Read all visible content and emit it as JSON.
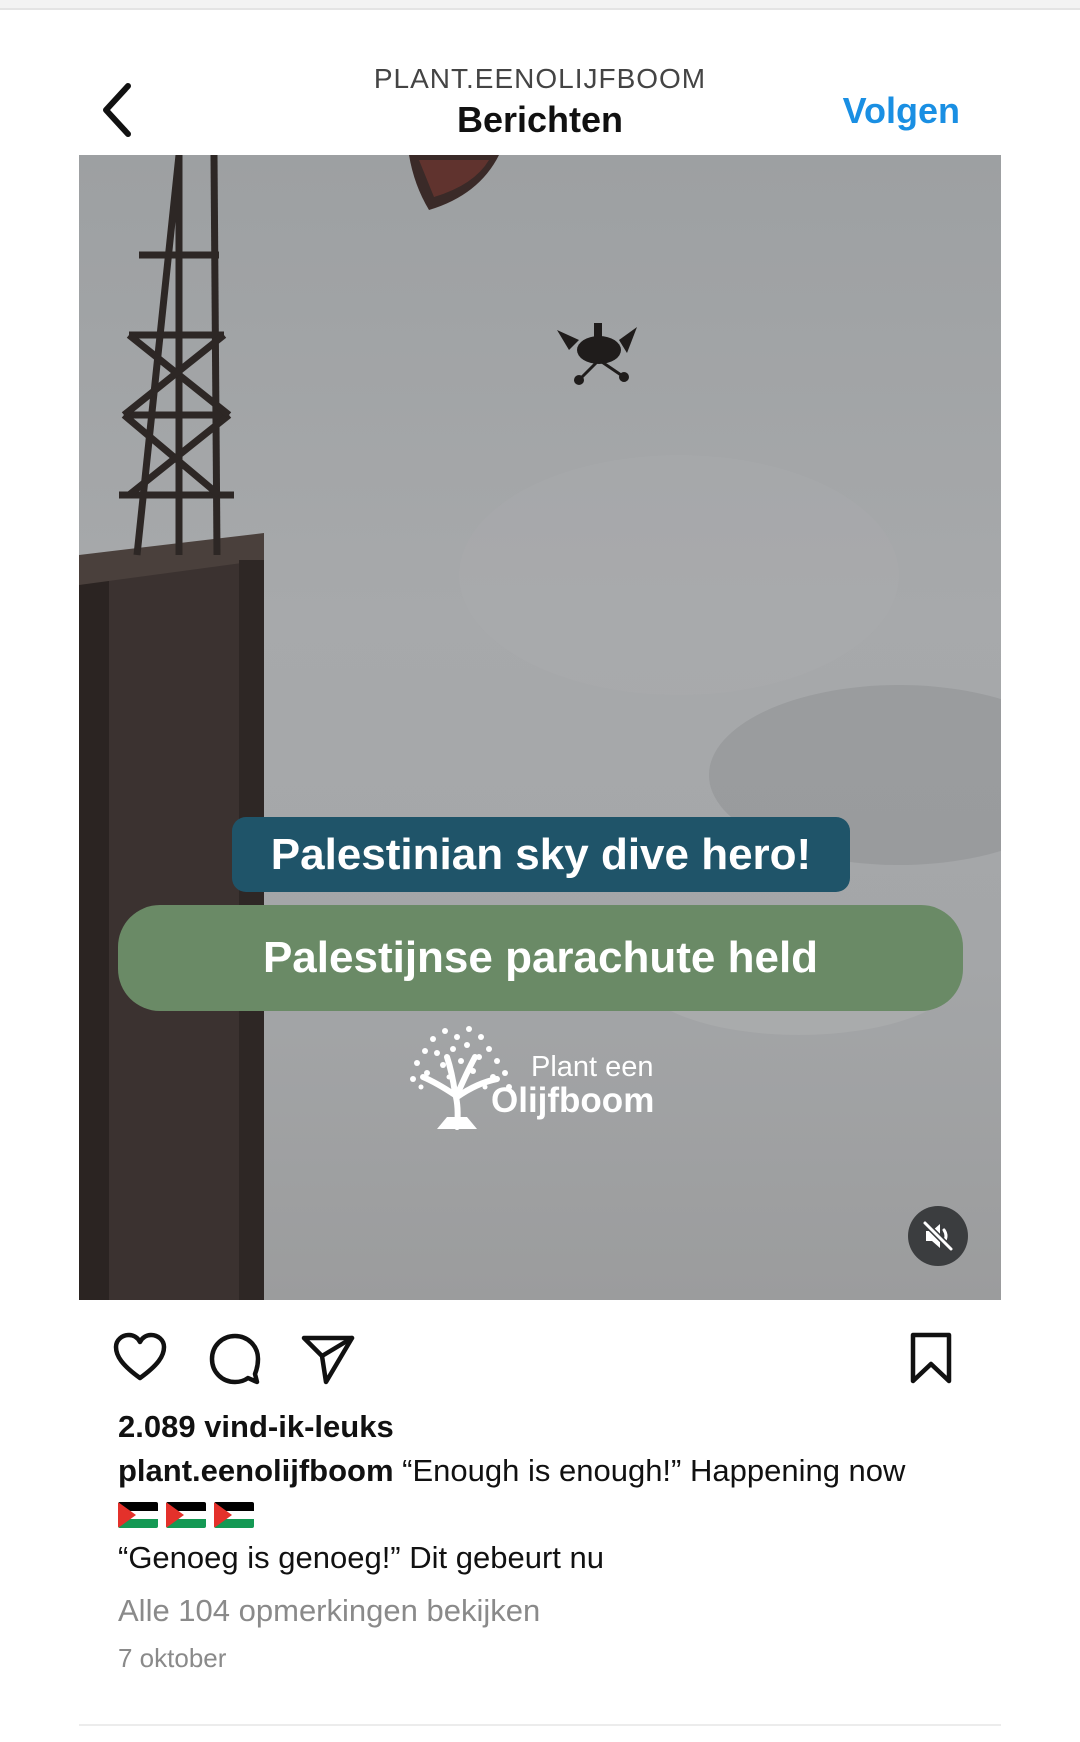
{
  "header": {
    "account_handle": "PLANT.EENOLIJFBOOM",
    "page_heading": "Berichten",
    "follow_label": "Volgen",
    "back_icon": "chevron-left-icon"
  },
  "video": {
    "caption_en": "Palestinian sky dive hero!",
    "caption_nl": "Palestijnse parachute held",
    "brand_line1": "Plant een",
    "brand_line2": "Olijfboom",
    "mute_icon": "speaker-muted-icon",
    "colors": {
      "caption_en_bg": "#1f5469",
      "caption_nl_bg": "#6a8a66"
    }
  },
  "actions": {
    "like_icon": "heart-icon",
    "comment_icon": "comment-icon",
    "share_icon": "send-icon",
    "save_icon": "bookmark-icon"
  },
  "post": {
    "likes": "2.089 vind-ik-leuks",
    "username": "plant.eenolijfboom",
    "caption_en": " “Enough is enough!” Happening now",
    "flag_icons": [
      "palestine-flag-icon",
      "palestine-flag-icon",
      "palestine-flag-icon"
    ],
    "caption_nl": "“Genoeg is genoeg!” Dit gebeurt nu",
    "view_comments": "Alle 104 opmerkingen bekijken",
    "date": "7 oktober"
  },
  "theme": {
    "link_color": "#1a8fe3"
  }
}
